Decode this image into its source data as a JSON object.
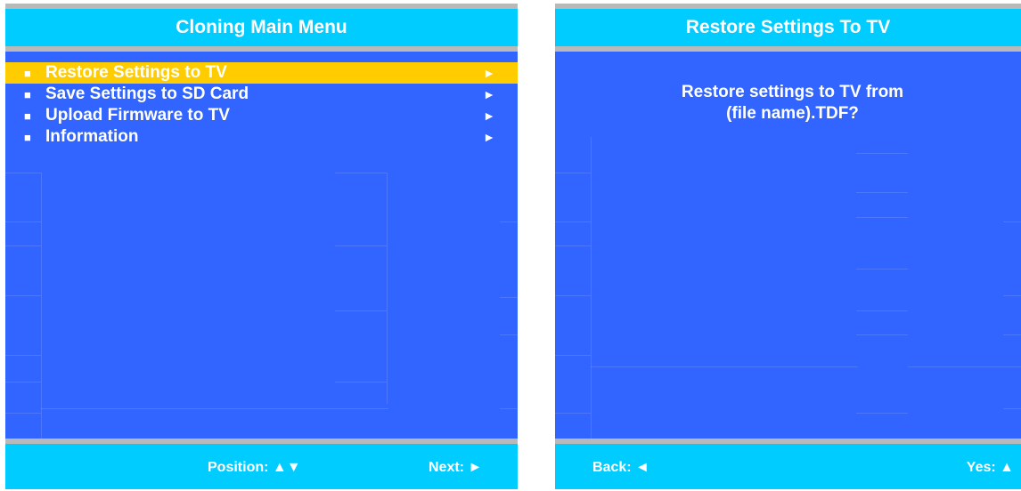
{
  "left_screen": {
    "title": "Cloning Main Menu",
    "menu": [
      {
        "bullet": "■",
        "label": "Restore Settings to TV",
        "arrow": "►",
        "selected": true
      },
      {
        "bullet": "■",
        "label": "Save Settings to SD Card",
        "arrow": "►",
        "selected": false
      },
      {
        "bullet": "■",
        "label": "Upload Firmware to TV",
        "arrow": "►",
        "selected": false
      },
      {
        "bullet": "■",
        "label": "Information",
        "arrow": "►",
        "selected": false
      }
    ],
    "footer": {
      "position_hint": "Position: ▲▼",
      "next_hint": "Next: ►"
    }
  },
  "right_screen": {
    "title": "Restore Settings To TV",
    "message_line1": "Restore settings to TV from",
    "message_line2": "(file name).TDF?",
    "footer": {
      "back_hint": "Back: ◄",
      "yes_hint": "Yes: ▲"
    }
  },
  "colors": {
    "screen_background": "#3264ff",
    "title_bar": "#00ccff",
    "selection_highlight": "#ffcc00",
    "divider": "#b9b9b9",
    "text": "#ffffff"
  }
}
